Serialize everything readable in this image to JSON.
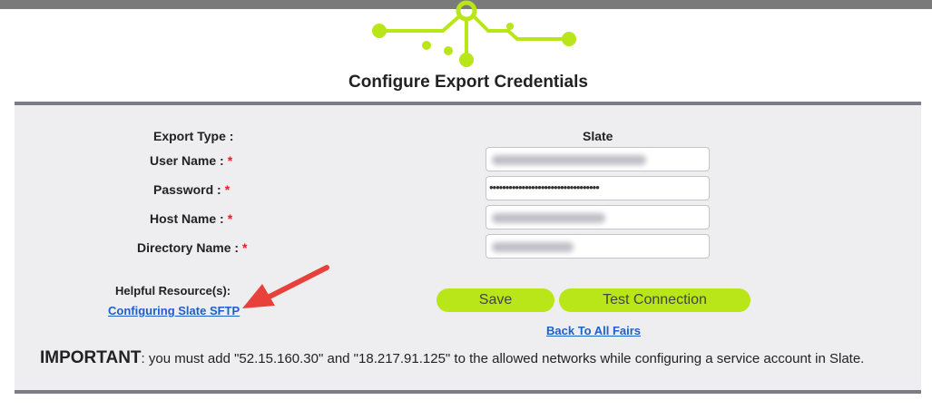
{
  "page": {
    "title": "Configure Export Credentials"
  },
  "colors": {
    "brand_green": "#b8e619",
    "link_blue": "#1f5fc8",
    "required_red": "#e02020",
    "panel_bg": "#eeeef0",
    "annotation_arrow": "#e8413b"
  },
  "form": {
    "export_type": {
      "label": "Export Type :",
      "value": "Slate"
    },
    "user_name": {
      "label": "User Name :",
      "required_mark": "*"
    },
    "password": {
      "label": "Password :",
      "required_mark": "*",
      "masked_value": "••••••••••••••••••••••••••••••••••"
    },
    "host_name": {
      "label": "Host Name :",
      "required_mark": "*"
    },
    "directory_name": {
      "label": "Directory Name :",
      "required_mark": "*"
    }
  },
  "resources": {
    "heading": "Helpful Resource(s):",
    "link": "Configuring Slate SFTP"
  },
  "actions": {
    "save": "Save",
    "test_connection": "Test Connection",
    "back_link": "Back To All Fairs"
  },
  "notice": {
    "heading": "IMPORTANT",
    "text": ": you must add \"52.15.160.30\" and \"18.217.91.125\" to the allowed networks  while configuring a service account in Slate."
  }
}
